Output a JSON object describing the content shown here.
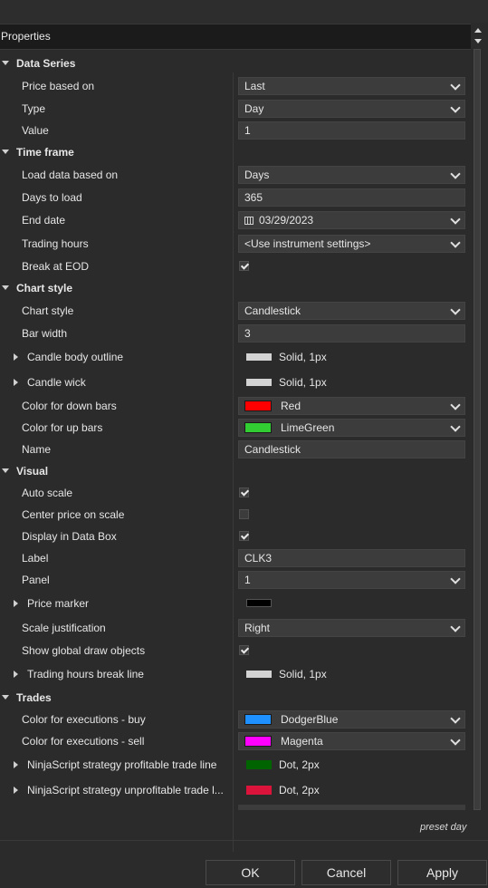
{
  "panel": {
    "title": "Properties",
    "preset": "preset day"
  },
  "categories": {
    "data_series": "Data Series",
    "time_frame": "Time frame",
    "chart_style": "Chart style",
    "visual": "Visual",
    "trades": "Trades"
  },
  "data_series": {
    "price_based_on": {
      "label": "Price based on",
      "value": "Last"
    },
    "type": {
      "label": "Type",
      "value": "Day"
    },
    "value": {
      "label": "Value",
      "value": "1"
    }
  },
  "time_frame": {
    "load_data_based_on": {
      "label": "Load data based on",
      "value": "Days"
    },
    "days_to_load": {
      "label": "Days to load",
      "value": "365"
    },
    "end_date": {
      "label": "End date",
      "value": "03/29/2023"
    },
    "trading_hours": {
      "label": "Trading hours",
      "value": "<Use instrument settings>"
    },
    "break_at_eod": {
      "label": "Break at EOD",
      "checked": true
    }
  },
  "chart_style": {
    "chart_style": {
      "label": "Chart style",
      "value": "Candlestick"
    },
    "bar_width": {
      "label": "Bar width",
      "value": "3"
    },
    "candle_body_outline": {
      "label": "Candle body outline",
      "value": "Solid, 1px",
      "color": "#d3d3d3"
    },
    "candle_wick": {
      "label": "Candle wick",
      "value": "Solid, 1px",
      "color": "#d3d3d3"
    },
    "down_color": {
      "label": "Color for down bars",
      "value": "Red",
      "color": "#ff0000"
    },
    "up_color": {
      "label": "Color for up bars",
      "value": "LimeGreen",
      "color": "#32cd32"
    },
    "name": {
      "label": "Name",
      "value": "Candlestick"
    }
  },
  "visual": {
    "auto_scale": {
      "label": "Auto scale",
      "checked": true
    },
    "center_price": {
      "label": "Center price on scale",
      "checked": false
    },
    "display_in_data_box": {
      "label": "Display in Data Box",
      "checked": true
    },
    "label": {
      "label": "Label",
      "value": "CLK3"
    },
    "panel": {
      "label": "Panel",
      "value": "1"
    },
    "price_marker": {
      "label": "Price marker",
      "color": "#000000"
    },
    "scale_justification": {
      "label": "Scale justification",
      "value": "Right"
    },
    "show_global_draw": {
      "label": "Show global draw objects",
      "checked": true
    },
    "trading_hours_break_line": {
      "label": "Trading hours break line",
      "value": "Solid, 1px",
      "color": "#d3d3d3"
    }
  },
  "trades": {
    "exec_buy": {
      "label": "Color for executions - buy",
      "value": "DodgerBlue",
      "color": "#1e90ff"
    },
    "exec_sell": {
      "label": "Color for executions - sell",
      "value": "Magenta",
      "color": "#ff00ff"
    },
    "profitable_line": {
      "label": "NinjaScript strategy profitable trade line",
      "value": "Dot, 2px",
      "color": "#006400"
    },
    "unprofitable_line": {
      "label": "NinjaScript strategy unprofitable trade l...",
      "value": "Dot, 2px",
      "color": "#dc143c"
    }
  },
  "buttons": {
    "ok": "OK",
    "cancel": "Cancel",
    "apply": "Apply"
  }
}
